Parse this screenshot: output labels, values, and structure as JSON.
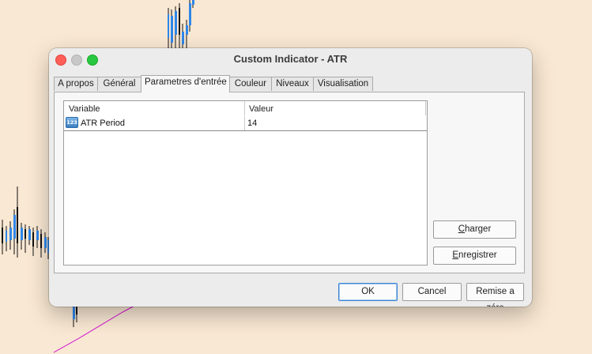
{
  "window": {
    "title": "Custom Indicator - ATR"
  },
  "tabs": [
    {
      "label": "A propos",
      "active": false
    },
    {
      "label": "Général",
      "active": false
    },
    {
      "label": "Parametres d'entrée",
      "active": true
    },
    {
      "label": "Couleur",
      "active": false
    },
    {
      "label": "Niveaux",
      "active": false
    },
    {
      "label": "Visualisation",
      "active": false
    }
  ],
  "grid": {
    "headers": {
      "variable": "Variable",
      "value": "Valeur"
    },
    "rows": [
      {
        "icon": "123",
        "variable": "ATR Period",
        "value": "14"
      }
    ]
  },
  "side_buttons": {
    "load": {
      "mnemonic": "C",
      "rest": "harger"
    },
    "save": {
      "mnemonic": "E",
      "rest": "nregistrer"
    }
  },
  "footer_buttons": {
    "ok": "OK",
    "cancel": "Cancel",
    "reset": "Remise a zéro"
  },
  "colors": {
    "background": "#f9e8d3",
    "candle_bull": "#2f86e8",
    "candle_bear": "#111111",
    "indicator_line": "#d400d4",
    "default_button": "#3e84d2"
  }
}
